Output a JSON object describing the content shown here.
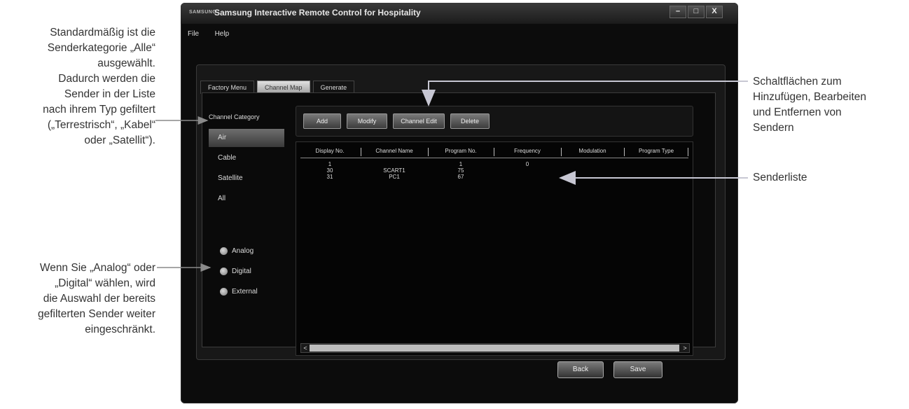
{
  "window": {
    "brand": "SAMSUNG",
    "title": "Samsung Interactive Remote Control for Hospitality",
    "controls": {
      "minimize": "–",
      "maximize": "□",
      "close": "X"
    }
  },
  "menu": [
    "File",
    "Help"
  ],
  "tabs": [
    {
      "label": "Factory Menu",
      "active": false
    },
    {
      "label": "Channel Map",
      "active": true
    },
    {
      "label": "Generate",
      "active": false
    }
  ],
  "category": {
    "title": "Channel Category",
    "items": [
      {
        "label": "Air",
        "selected": true
      },
      {
        "label": "Cable",
        "selected": false
      },
      {
        "label": "Satellite",
        "selected": false
      },
      {
        "label": "All",
        "selected": false
      }
    ],
    "filters": [
      {
        "label": "Analog"
      },
      {
        "label": "Digital"
      },
      {
        "label": "External"
      }
    ]
  },
  "toolbar": {
    "add_label": "Add",
    "modify_label": "Modify",
    "channel_edit_label": "Channel Edit",
    "delete_label": "Delete"
  },
  "table": {
    "columns": [
      "Display No.",
      "Channel Name",
      "Program No.",
      "Frequency",
      "Modulation",
      "Program Type"
    ],
    "rows": [
      [
        "1",
        "",
        "1",
        "0",
        "",
        ""
      ],
      [
        "30",
        "SCART1",
        "75",
        "",
        "",
        ""
      ],
      [
        "31",
        "PC1",
        "67",
        "",
        "",
        ""
      ]
    ],
    "scroll_left": "<",
    "scroll_right": ">"
  },
  "footer": {
    "back_label": "Back",
    "save_label": "Save"
  },
  "annotations": {
    "top_left": [
      "Standardmäßig ist die",
      "Senderkategorie „Alle“",
      "ausgewählt.",
      "Dadurch werden die",
      "Sender in der Liste",
      "nach ihrem Typ gefiltert",
      "(„Terrestrisch“, „Kabel“",
      "oder „Satellit“)."
    ],
    "bottom_left": [
      "Wenn Sie „Analog“ oder",
      "„Digital“ wählen, wird",
      "die Auswahl der bereits",
      "gefilterten Sender weiter",
      "eingeschränkt."
    ],
    "top_right": [
      "Schaltflächen zum",
      "Hinzufügen, Bearbeiten",
      "und Entfernen von",
      "Sendern"
    ],
    "mid_right": [
      "Senderliste"
    ]
  }
}
